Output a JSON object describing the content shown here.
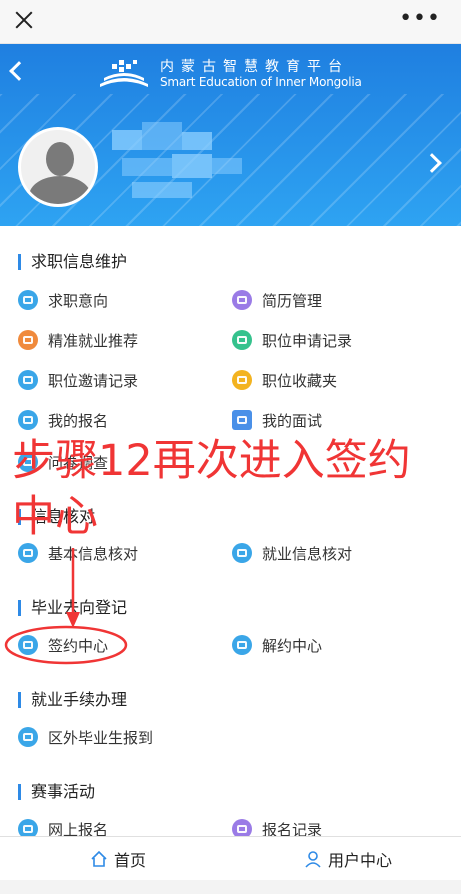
{
  "header": {
    "brand_cn": "内蒙古智慧教育平台",
    "brand_en": "Smart Education of Inner Mongolia"
  },
  "sections": {
    "job_info": {
      "title": "求职信息维护",
      "items": [
        "求职意向",
        "简历管理",
        "精准就业推荐",
        "职位申请记录",
        "职位邀请记录",
        "职位收藏夹",
        "我的报名",
        "我的面试",
        "问卷调查"
      ]
    },
    "verify": {
      "title": "信息核对",
      "items": [
        "基本信息核对",
        "就业信息核对"
      ]
    },
    "destination": {
      "title": "毕业去向登记",
      "items": [
        "签约中心",
        "解约中心"
      ]
    },
    "procedures": {
      "title": "就业手续办理",
      "items": [
        "区外毕业生报到"
      ]
    },
    "events": {
      "title": "赛事活动",
      "items": [
        "网上报名",
        "报名记录"
      ]
    }
  },
  "annotation": {
    "line1": "步骤12再次进入签约",
    "line2": "中心",
    "color": "#f03535"
  },
  "bottom_nav": {
    "home": "首页",
    "user_center": "用户中心"
  },
  "colors": {
    "header_blue": "#2e8ae6",
    "accent": "#2e8ae6"
  }
}
